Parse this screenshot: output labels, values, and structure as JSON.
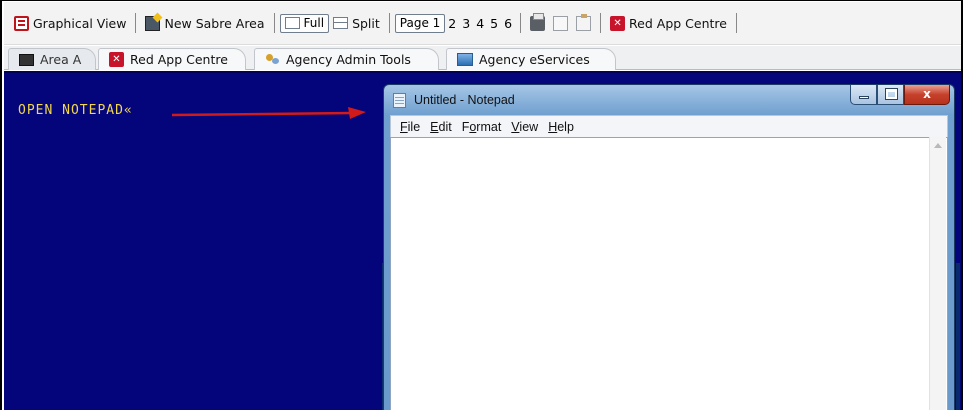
{
  "toolbar": {
    "graphical_view": "Graphical View",
    "new_sabre_area": "New Sabre Area",
    "full": "Full",
    "split": "Split",
    "pages": [
      "Page 1",
      "2",
      "3",
      "4",
      "5",
      "6"
    ],
    "red_app_centre": "Red App Centre"
  },
  "tabs": [
    {
      "label": "Area A",
      "icon": "terminal-icon",
      "active": true
    },
    {
      "label": "Red App Centre",
      "icon": "red-app-icon",
      "active": false
    },
    {
      "label": "Agency Admin Tools",
      "icon": "keys-icon",
      "active": false
    },
    {
      "label": "Agency eServices",
      "icon": "eservices-icon",
      "active": false
    }
  ],
  "terminal": {
    "command_text": "OPEN NOTEPAD«",
    "background": "#04047b",
    "text_color": "#f2d84a",
    "arrow_color": "#d11a1a"
  },
  "notepad": {
    "title": "Untitled - Notepad",
    "menus": [
      {
        "first": "F",
        "rest": "ile"
      },
      {
        "first": "E",
        "rest": "dit"
      },
      {
        "first": "F",
        "rest": "ormat",
        "pre": "",
        "underline_index": 1
      },
      {
        "first": "V",
        "rest": "iew"
      },
      {
        "first": "H",
        "rest": "elp"
      }
    ],
    "controls": [
      "minimize",
      "maximize",
      "close"
    ],
    "close_glyph": "x",
    "content": ""
  }
}
